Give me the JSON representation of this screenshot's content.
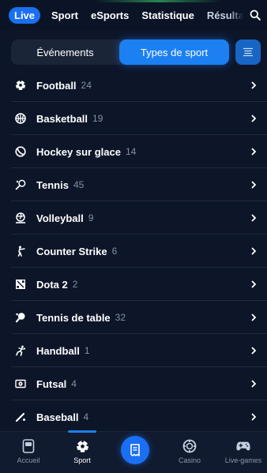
{
  "top_tabs": {
    "live": "Live",
    "sport": "Sport",
    "esports": "eSports",
    "statistics": "Statistique",
    "results": "Résulta"
  },
  "segment": {
    "events": "Événements",
    "types": "Types de sport"
  },
  "sports": [
    {
      "name": "Football",
      "count": "24",
      "icon": "soccer-ball-icon"
    },
    {
      "name": "Basketball",
      "count": "19",
      "icon": "basketball-icon"
    },
    {
      "name": "Hockey sur glace",
      "count": "14",
      "icon": "hockey-puck-icon"
    },
    {
      "name": "Tennis",
      "count": "45",
      "icon": "tennis-racket-icon"
    },
    {
      "name": "Volleyball",
      "count": "9",
      "icon": "volleyball-icon"
    },
    {
      "name": "Counter Strike",
      "count": "6",
      "icon": "counter-strike-icon"
    },
    {
      "name": "Dota 2",
      "count": "2",
      "icon": "dota-icon"
    },
    {
      "name": "Tennis de table",
      "count": "32",
      "icon": "table-tennis-icon"
    },
    {
      "name": "Handball",
      "count": "1",
      "icon": "handball-icon"
    },
    {
      "name": "Futsal",
      "count": "4",
      "icon": "futsal-icon"
    },
    {
      "name": "Baseball",
      "count": "4",
      "icon": "baseball-icon"
    }
  ],
  "bottom_nav": {
    "home": "Accueil",
    "sport": "Sport",
    "casino": "Casino",
    "live_games": "Live-games"
  },
  "colors": {
    "background": "#0d1629",
    "accent": "#1c80f2",
    "muted_text": "#8490a3"
  }
}
